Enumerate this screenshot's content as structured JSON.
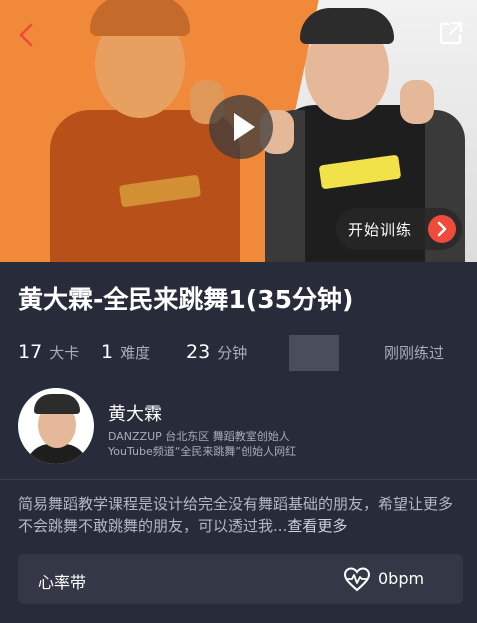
{
  "hero": {
    "train_button_label": "开始训练",
    "icons": [
      "back-icon",
      "share-icon",
      "play-icon",
      "arrow-right-icon"
    ]
  },
  "course": {
    "title": "黄大霖-全民来跳舞1(35分钟)"
  },
  "stats": [
    {
      "value": "17",
      "unit": "大卡"
    },
    {
      "value": "1",
      "unit": "难度"
    },
    {
      "value": "23",
      "unit": "分钟"
    }
  ],
  "recent_label": "刚刚练过",
  "coach": {
    "name": "黄大霖",
    "description_line1": "DANZZUP 台北东区 舞蹈教室创始人",
    "description_line2": "YouTube频道“全民来跳舞”创始人网红"
  },
  "description": {
    "text": "简易舞蹈教学课程是设计给完全没有舞蹈基础的朋友，希望让更多不会跳舞不敢跳舞的朋友，可以透过我...",
    "more_label": "查看更多"
  },
  "heart_rate": {
    "label": "心率带",
    "value": "0bpm",
    "icon": "heart-pulse-icon"
  },
  "colors": {
    "background": "#282c3a",
    "accent": "#f04a3a",
    "hero_orange": "#f0893a",
    "muted_text": "#a9adb8"
  }
}
